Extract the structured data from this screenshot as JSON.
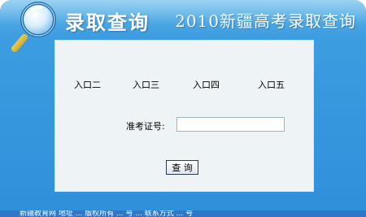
{
  "header": {
    "brand_title": "录取查询",
    "subtitle": "2010新疆高考录取查询"
  },
  "entries": [
    {
      "label": "入口二"
    },
    {
      "label": "入口三"
    },
    {
      "label": "入口四"
    },
    {
      "label": "入口五"
    }
  ],
  "form": {
    "exam_number_label": "准考证号:",
    "exam_number_value": "",
    "query_button": "查 询"
  },
  "footer": {
    "text": "新疆教育网 地址 ... 版权所有 ... 号 ... 联系方式 ... 号"
  },
  "colors": {
    "panel_blue": "#3d9de0",
    "content_bg": "#eef4f6",
    "bottom_bar": "#2f78c9"
  },
  "icons": {
    "header_icon": "magnifier-icon"
  }
}
